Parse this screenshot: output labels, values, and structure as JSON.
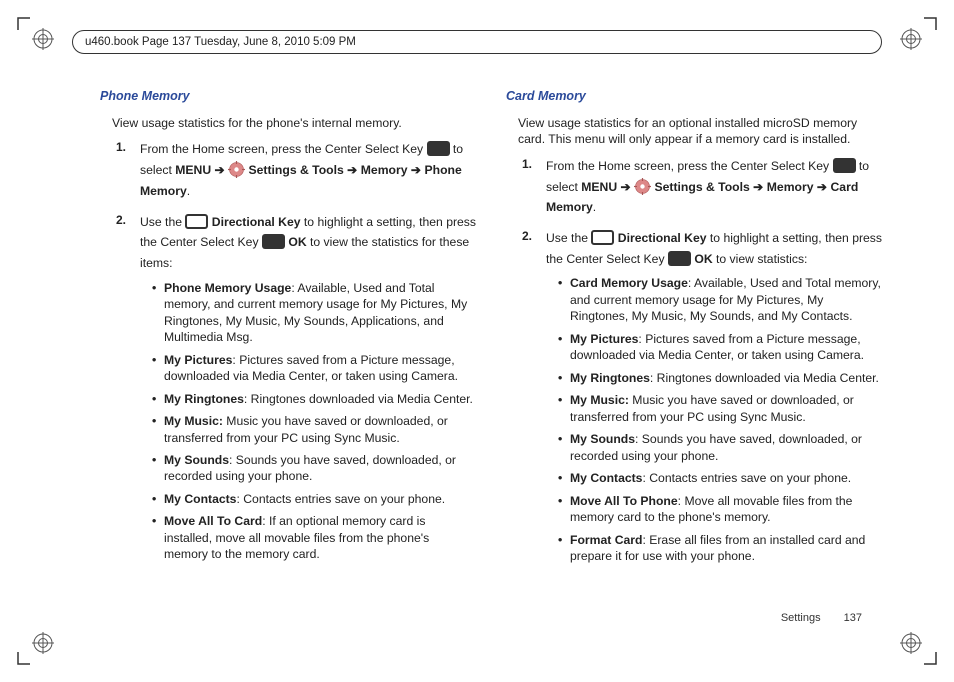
{
  "header": "u460.book  Page 137  Tuesday, June 8, 2010  5:09 PM",
  "left": {
    "title": "Phone Memory",
    "intro": "View usage statistics for the phone's internal memory.",
    "step1_a": "From the Home screen, press the Center Select Key ",
    "step1_b": " to select ",
    "step1_menu": "MENU",
    "step1_c": " ",
    "step1_settings": "Settings & Tools",
    "step1_d": " ",
    "step1_memory": "Memory",
    "step1_e": " ",
    "step1_phone": "Phone Memory",
    "step1_f": ".",
    "step2_a": "Use the ",
    "step2_dir": "Directional Key",
    "step2_b": " to highlight a setting, then press the Center Select Key ",
    "step2_ok": "OK",
    "step2_c": " to view the statistics for these items:",
    "b1_t": "Phone Memory Usage",
    "b1_d": ": Available, Used and Total memory, and current memory usage for My Pictures, My Ringtones, My Music, My Sounds, Applications, and Multimedia Msg.",
    "b2_t": "My Pictures",
    "b2_d": ": Pictures saved from a Picture message, downloaded via Media Center, or taken using Camera.",
    "b3_t": "My Ringtones",
    "b3_d": ": Ringtones downloaded via Media Center.",
    "b4_t": "My Music:",
    "b4_d": " Music you have saved or downloaded, or transferred from your PC using Sync Music.",
    "b5_t": "My Sounds",
    "b5_d": ": Sounds you have saved, downloaded, or recorded using your phone.",
    "b6_t": "My Contacts",
    "b6_d": ": Contacts entries save on your phone.",
    "b7_t": "Move All To Card",
    "b7_d": ": If an optional memory card is installed, move all movable files from the phone's memory to the memory card."
  },
  "right": {
    "title": "Card Memory",
    "intro": "View usage statistics for an optional installed microSD memory card. This menu will only appear if a memory card is installed.",
    "step1_a": "From the Home screen, press the Center Select Key ",
    "step1_b": " to select ",
    "step1_menu": "MENU",
    "step1_c": " ",
    "step1_settings": "Settings & Tools",
    "step1_d": " ",
    "step1_memory": "Memory",
    "step1_e": " ",
    "step1_card": "Card Memory",
    "step1_f": ".",
    "step2_a": "Use the ",
    "step2_dir": "Directional Key",
    "step2_b": " to highlight a setting, then press the Center Select Key ",
    "step2_ok": "OK",
    "step2_c": " to view statistics:",
    "b1_t": "Card Memory Usage",
    "b1_d": ": Available, Used and Total memory, and current memory usage for My Pictures, My Ringtones, My Music, My Sounds, and My Contacts.",
    "b2_t": "My Pictures",
    "b2_d": ": Pictures saved from a Picture message, downloaded via Media Center, or taken using Camera.",
    "b3_t": "My Ringtones",
    "b3_d": ": Ringtones downloaded via Media Center.",
    "b4_t": "My Music:",
    "b4_d": " Music you have saved or downloaded, or transferred from your PC using Sync Music.",
    "b5_t": "My Sounds",
    "b5_d": ": Sounds you have saved, downloaded, or recorded using your phone.",
    "b6_t": "My Contacts",
    "b6_d": ": Contacts entries save on your phone.",
    "b7_t": "Move All To Phone",
    "b7_d": ": Move all movable files from the memory card to the phone's memory.",
    "b8_t": "Format Card",
    "b8_d": ": Erase all files from an installed card and prepare it for use with your phone."
  },
  "footer": {
    "section": "Settings",
    "page": "137"
  },
  "arrow": "➔"
}
